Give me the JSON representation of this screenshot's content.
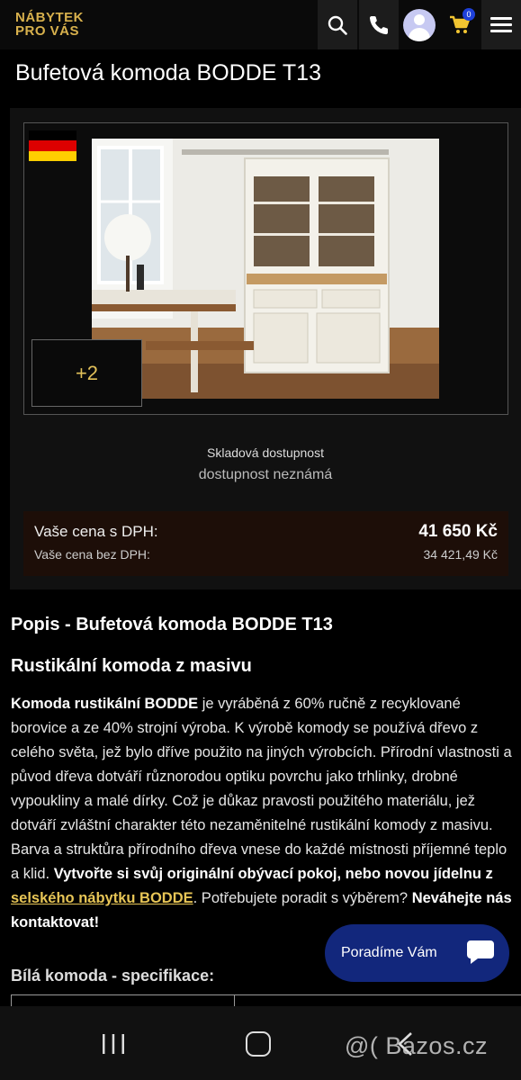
{
  "header": {
    "logo_line1": "NÁBYTEK",
    "logo_line2": "PRO VÁS",
    "cart_count": "0",
    "icons": [
      "search-icon",
      "phone-icon",
      "user-avatar-icon",
      "cart-icon",
      "menu-icon"
    ]
  },
  "product": {
    "title": "Bufetová komoda BODDE T13",
    "more_images": "+2",
    "stock_label": "Skladová dostupnost",
    "stock_value": "dostupnost neznámá",
    "price_with_vat_label": "Vaše cena s DPH:",
    "price_with_vat": "41 650 Kč",
    "price_without_vat_label": "Vaše cena bez DPH:",
    "price_without_vat": "34 421,49 Kč"
  },
  "description": {
    "heading": "Popis - Bufetová komoda BODDE T13",
    "subheading": "Rustikální komoda z masivu",
    "intro_bold": "Komoda rustikální BODDE",
    "body": " je vyráběná z 60% ručně z recyklované borovice a ze 40% strojní výroba. K výrobě komody se používá dřevo z celého světa, jež bylo dříve použito na jiných výrobcích. Přírodní vlastnosti a původ dřeva dotváří různorodou optiku povrchu jako trhlinky, drobné vypoukliny a malé dírky. Což je důkaz pravosti použitého materiálu, jež dotváří zvláštní charakter této nezaměnitelné rustikální komody z masivu. Barva a struktůra přírodního dřeva vnese do každé místnosti příjemné teplo a klid. ",
    "cta_bold": "Vytvořte si svůj originální obývací pokoj, nebo novou jídelnu z ",
    "cta_link": "selského nábytku BODDE",
    "after_link": ". Potřebujete poradit s výběrem? ",
    "contact_bold": "Neváhejte nás kontaktovat!",
    "spec_heading": "Bílá komoda - specifikace:"
  },
  "chat": {
    "label": "Poradíme Vám"
  },
  "watermark": "@( Bazos.cz",
  "colors": {
    "gold": "#d8b14d",
    "price_bg": "#1d0e08",
    "chat_bg": "#12277c"
  }
}
